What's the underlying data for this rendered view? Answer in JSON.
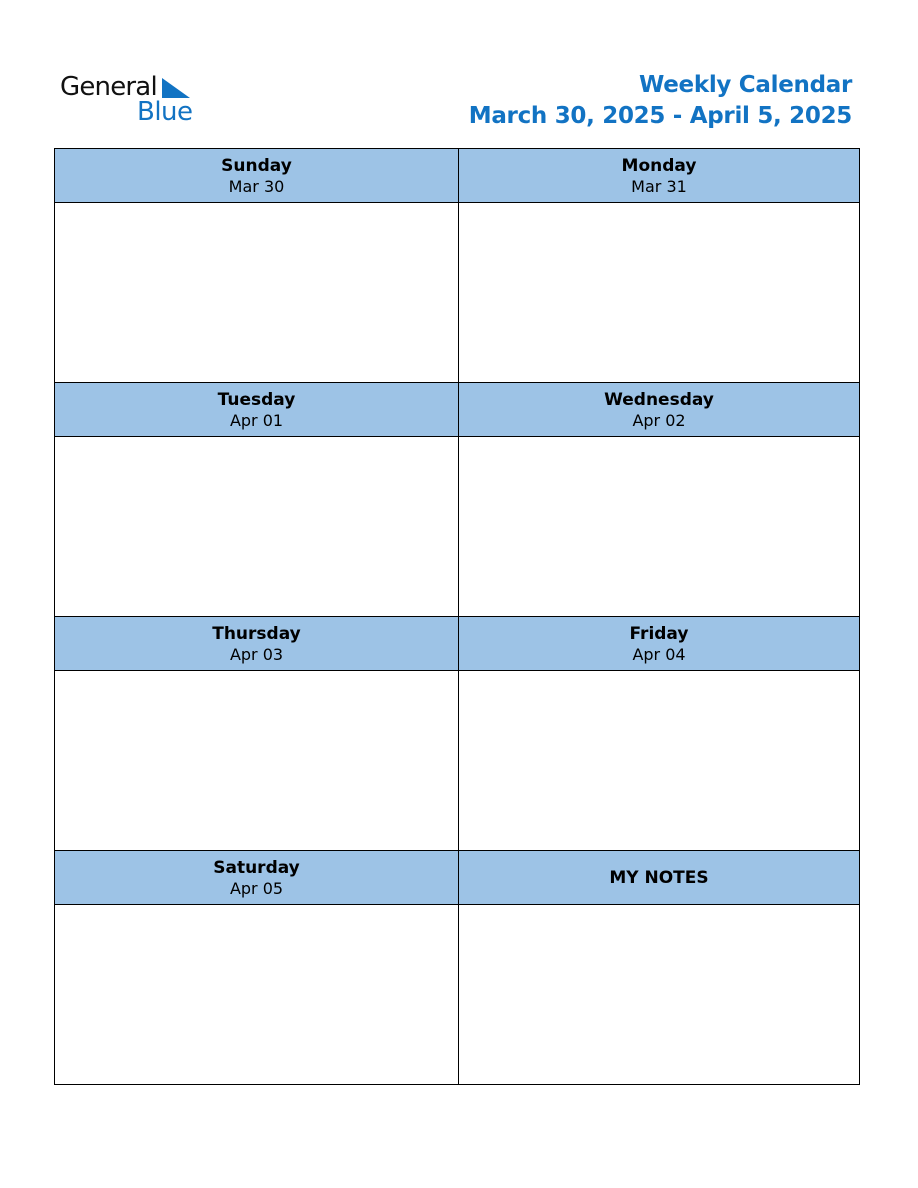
{
  "logo": {
    "line1": "General",
    "line2": "Blue",
    "icon": "triangle-icon"
  },
  "header": {
    "title": "Weekly Calendar",
    "range": "March 30, 2025 - April 5, 2025"
  },
  "colors": {
    "brand_blue": "#1273c3",
    "header_fill": "#9dc3e6"
  },
  "days": [
    {
      "name": "Sunday",
      "date": "Mar 30"
    },
    {
      "name": "Monday",
      "date": "Mar 31"
    },
    {
      "name": "Tuesday",
      "date": "Apr 01"
    },
    {
      "name": "Wednesday",
      "date": "Apr 02"
    },
    {
      "name": "Thursday",
      "date": "Apr 03"
    },
    {
      "name": "Friday",
      "date": "Apr 04"
    },
    {
      "name": "Saturday",
      "date": "Apr 05"
    }
  ],
  "notes": {
    "label": "MY NOTES"
  }
}
